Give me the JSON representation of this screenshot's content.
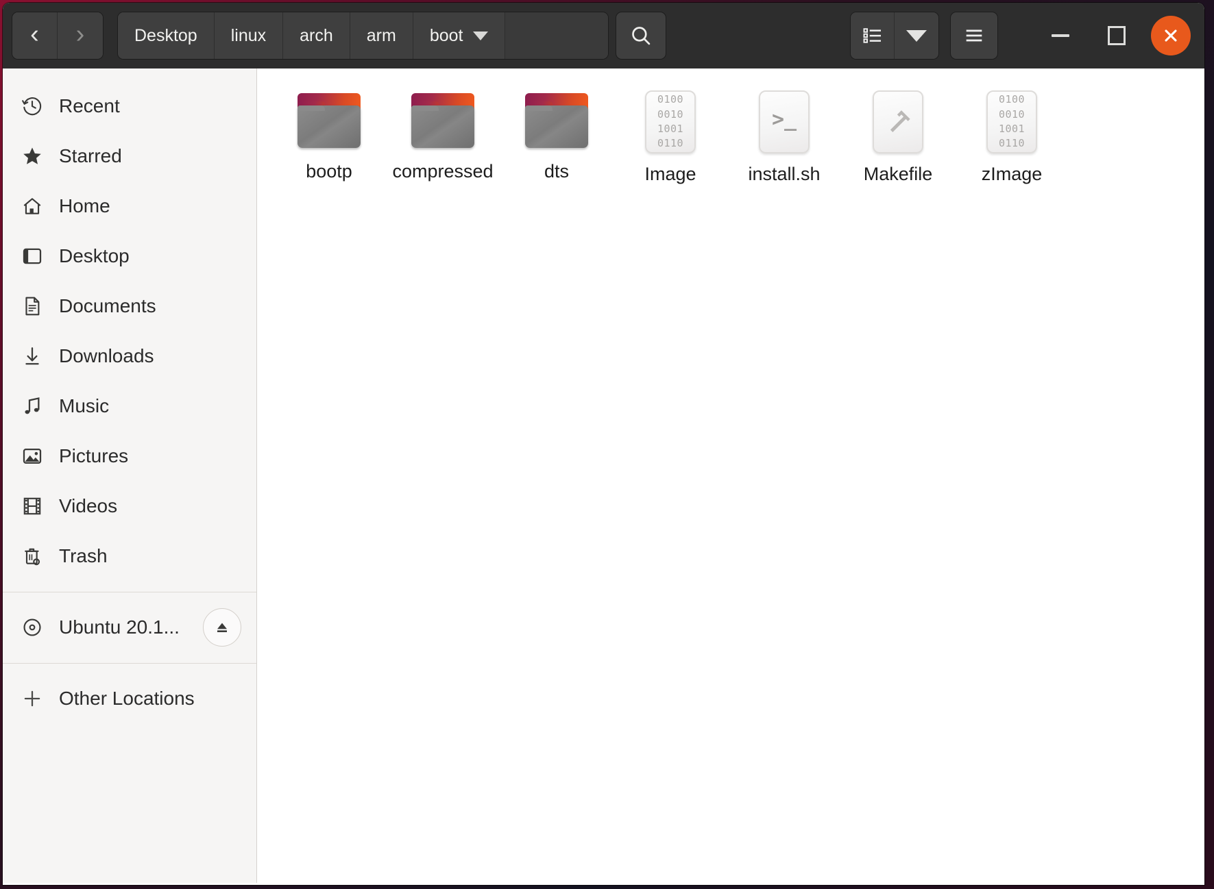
{
  "window": {
    "title": "boot",
    "app": "Files"
  },
  "headerbar": {
    "nav": {
      "back_label": "‹",
      "back_name": "back",
      "forward_label": "›",
      "forward_name": "forward"
    },
    "breadcrumb": [
      {
        "label": "Desktop",
        "has_caret": false
      },
      {
        "label": "linux",
        "has_caret": false
      },
      {
        "label": "arch",
        "has_caret": false
      },
      {
        "label": "arm",
        "has_caret": false
      },
      {
        "label": "boot",
        "has_caret": true
      }
    ],
    "search_icon": "search-icon",
    "view_list_icon": "list-view-icon",
    "view_dropdown_icon": "chevron-down-icon",
    "menu_icon": "hamburger-menu-icon",
    "window_controls": {
      "minimize": "minimize-icon",
      "maximize": "maximize-icon",
      "close": "close-icon",
      "close_color": "#e8591c"
    }
  },
  "sidebar": {
    "items": [
      {
        "label": "Recent",
        "icon": "clock-history-icon"
      },
      {
        "label": "Starred",
        "icon": "star-icon"
      },
      {
        "label": "Home",
        "icon": "home-icon"
      },
      {
        "label": "Desktop",
        "icon": "desktop-icon"
      },
      {
        "label": "Documents",
        "icon": "document-icon"
      },
      {
        "label": "Downloads",
        "icon": "download-arrow-icon"
      },
      {
        "label": "Music",
        "icon": "music-note-icon"
      },
      {
        "label": "Pictures",
        "icon": "picture-icon"
      },
      {
        "label": "Videos",
        "icon": "film-strip-icon"
      },
      {
        "label": "Trash",
        "icon": "trash-icon"
      }
    ],
    "devices": [
      {
        "label": "Ubuntu 20.1...",
        "icon": "disc-icon",
        "eject_icon": "eject-icon"
      }
    ],
    "other": {
      "label": "Other Locations",
      "icon": "plus-icon"
    }
  },
  "content": {
    "files": [
      {
        "name": "bootp",
        "type": "folder"
      },
      {
        "name": "compressed",
        "type": "folder"
      },
      {
        "name": "dts",
        "type": "folder"
      },
      {
        "name": "Image",
        "type": "binary",
        "binary_lines": [
          "0100",
          "0010",
          "1001",
          "0110"
        ]
      },
      {
        "name": "install.sh",
        "type": "script",
        "glyph": ">_"
      },
      {
        "name": "Makefile",
        "type": "makefile"
      },
      {
        "name": "zImage",
        "type": "binary",
        "binary_lines": [
          "0100",
          "0010",
          "1001",
          "0110"
        ]
      }
    ]
  }
}
